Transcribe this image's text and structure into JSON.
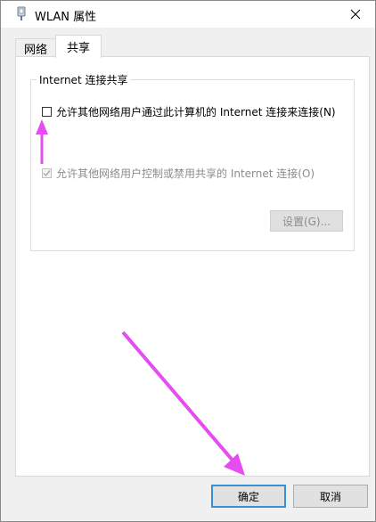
{
  "window": {
    "title": "WLAN 属性",
    "icon": "network-adapter-icon",
    "close_icon": "close-icon"
  },
  "tabs": [
    {
      "label": "网络",
      "selected": false
    },
    {
      "label": "共享",
      "selected": true
    }
  ],
  "sharing": {
    "group_label": "Internet 连接共享",
    "allow_share_label": "允许其他网络用户通过此计算机的 Internet 连接来连接(N)",
    "allow_share_checked": false,
    "allow_control_label": "允许其他网络用户控制或禁用共享的 Internet 连接(O)",
    "allow_control_checked": true,
    "allow_control_enabled": false,
    "settings_label": "设置(G)...",
    "settings_enabled": false
  },
  "footer": {
    "ok_label": "确定",
    "cancel_label": "取消"
  },
  "annotations": {
    "arrow_color": "#e64df0"
  }
}
